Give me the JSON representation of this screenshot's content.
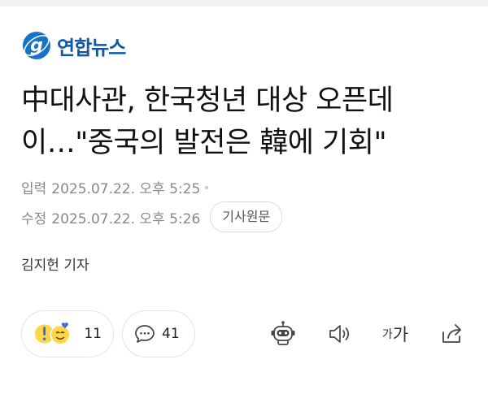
{
  "brand": {
    "name": "연합뉴스",
    "color": "#0c5aa6"
  },
  "article": {
    "headline_line1": "中대사관, 한국청년 대상 오픈데",
    "headline_line2": "이…\"중국의 발전은 韓에 기회\"",
    "published": {
      "label": "입력",
      "datetime": "2025.07.22. 오후 5:25"
    },
    "modified": {
      "label": "수정",
      "datetime": "2025.07.22. 오후 5:26"
    },
    "original_button": "기사원문",
    "reporter": "김지헌 기자"
  },
  "actions": {
    "reactions": {
      "count": "11",
      "icons": [
        "surprised-emoji-icon",
        "smile-emoji-icon"
      ]
    },
    "comments": {
      "count": "41",
      "icon": "comment-bubble-icon"
    },
    "tools": [
      {
        "icon": "robot-summary-icon"
      },
      {
        "icon": "speaker-icon"
      },
      {
        "icon": "font-size-icon",
        "label_small": "가",
        "label_large": "가"
      },
      {
        "icon": "share-icon"
      }
    ]
  }
}
